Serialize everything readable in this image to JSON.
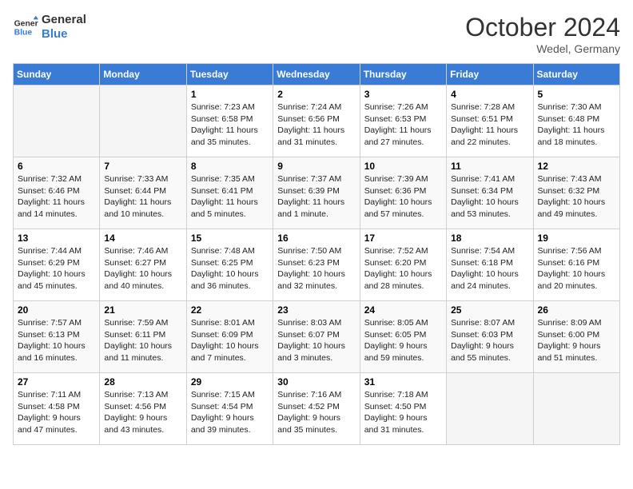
{
  "header": {
    "logo_line1": "General",
    "logo_line2": "Blue",
    "month": "October 2024",
    "location": "Wedel, Germany"
  },
  "weekdays": [
    "Sunday",
    "Monday",
    "Tuesday",
    "Wednesday",
    "Thursday",
    "Friday",
    "Saturday"
  ],
  "weeks": [
    [
      {
        "day": "",
        "text": ""
      },
      {
        "day": "",
        "text": ""
      },
      {
        "day": "1",
        "text": "Sunrise: 7:23 AM\nSunset: 6:58 PM\nDaylight: 11 hours and 35 minutes."
      },
      {
        "day": "2",
        "text": "Sunrise: 7:24 AM\nSunset: 6:56 PM\nDaylight: 11 hours and 31 minutes."
      },
      {
        "day": "3",
        "text": "Sunrise: 7:26 AM\nSunset: 6:53 PM\nDaylight: 11 hours and 27 minutes."
      },
      {
        "day": "4",
        "text": "Sunrise: 7:28 AM\nSunset: 6:51 PM\nDaylight: 11 hours and 22 minutes."
      },
      {
        "day": "5",
        "text": "Sunrise: 7:30 AM\nSunset: 6:48 PM\nDaylight: 11 hours and 18 minutes."
      }
    ],
    [
      {
        "day": "6",
        "text": "Sunrise: 7:32 AM\nSunset: 6:46 PM\nDaylight: 11 hours and 14 minutes."
      },
      {
        "day": "7",
        "text": "Sunrise: 7:33 AM\nSunset: 6:44 PM\nDaylight: 11 hours and 10 minutes."
      },
      {
        "day": "8",
        "text": "Sunrise: 7:35 AM\nSunset: 6:41 PM\nDaylight: 11 hours and 5 minutes."
      },
      {
        "day": "9",
        "text": "Sunrise: 7:37 AM\nSunset: 6:39 PM\nDaylight: 11 hours and 1 minute."
      },
      {
        "day": "10",
        "text": "Sunrise: 7:39 AM\nSunset: 6:36 PM\nDaylight: 10 hours and 57 minutes."
      },
      {
        "day": "11",
        "text": "Sunrise: 7:41 AM\nSunset: 6:34 PM\nDaylight: 10 hours and 53 minutes."
      },
      {
        "day": "12",
        "text": "Sunrise: 7:43 AM\nSunset: 6:32 PM\nDaylight: 10 hours and 49 minutes."
      }
    ],
    [
      {
        "day": "13",
        "text": "Sunrise: 7:44 AM\nSunset: 6:29 PM\nDaylight: 10 hours and 45 minutes."
      },
      {
        "day": "14",
        "text": "Sunrise: 7:46 AM\nSunset: 6:27 PM\nDaylight: 10 hours and 40 minutes."
      },
      {
        "day": "15",
        "text": "Sunrise: 7:48 AM\nSunset: 6:25 PM\nDaylight: 10 hours and 36 minutes."
      },
      {
        "day": "16",
        "text": "Sunrise: 7:50 AM\nSunset: 6:23 PM\nDaylight: 10 hours and 32 minutes."
      },
      {
        "day": "17",
        "text": "Sunrise: 7:52 AM\nSunset: 6:20 PM\nDaylight: 10 hours and 28 minutes."
      },
      {
        "day": "18",
        "text": "Sunrise: 7:54 AM\nSunset: 6:18 PM\nDaylight: 10 hours and 24 minutes."
      },
      {
        "day": "19",
        "text": "Sunrise: 7:56 AM\nSunset: 6:16 PM\nDaylight: 10 hours and 20 minutes."
      }
    ],
    [
      {
        "day": "20",
        "text": "Sunrise: 7:57 AM\nSunset: 6:13 PM\nDaylight: 10 hours and 16 minutes."
      },
      {
        "day": "21",
        "text": "Sunrise: 7:59 AM\nSunset: 6:11 PM\nDaylight: 10 hours and 11 minutes."
      },
      {
        "day": "22",
        "text": "Sunrise: 8:01 AM\nSunset: 6:09 PM\nDaylight: 10 hours and 7 minutes."
      },
      {
        "day": "23",
        "text": "Sunrise: 8:03 AM\nSunset: 6:07 PM\nDaylight: 10 hours and 3 minutes."
      },
      {
        "day": "24",
        "text": "Sunrise: 8:05 AM\nSunset: 6:05 PM\nDaylight: 9 hours and 59 minutes."
      },
      {
        "day": "25",
        "text": "Sunrise: 8:07 AM\nSunset: 6:03 PM\nDaylight: 9 hours and 55 minutes."
      },
      {
        "day": "26",
        "text": "Sunrise: 8:09 AM\nSunset: 6:00 PM\nDaylight: 9 hours and 51 minutes."
      }
    ],
    [
      {
        "day": "27",
        "text": "Sunrise: 7:11 AM\nSunset: 4:58 PM\nDaylight: 9 hours and 47 minutes."
      },
      {
        "day": "28",
        "text": "Sunrise: 7:13 AM\nSunset: 4:56 PM\nDaylight: 9 hours and 43 minutes."
      },
      {
        "day": "29",
        "text": "Sunrise: 7:15 AM\nSunset: 4:54 PM\nDaylight: 9 hours and 39 minutes."
      },
      {
        "day": "30",
        "text": "Sunrise: 7:16 AM\nSunset: 4:52 PM\nDaylight: 9 hours and 35 minutes."
      },
      {
        "day": "31",
        "text": "Sunrise: 7:18 AM\nSunset: 4:50 PM\nDaylight: 9 hours and 31 minutes."
      },
      {
        "day": "",
        "text": ""
      },
      {
        "day": "",
        "text": ""
      }
    ]
  ]
}
